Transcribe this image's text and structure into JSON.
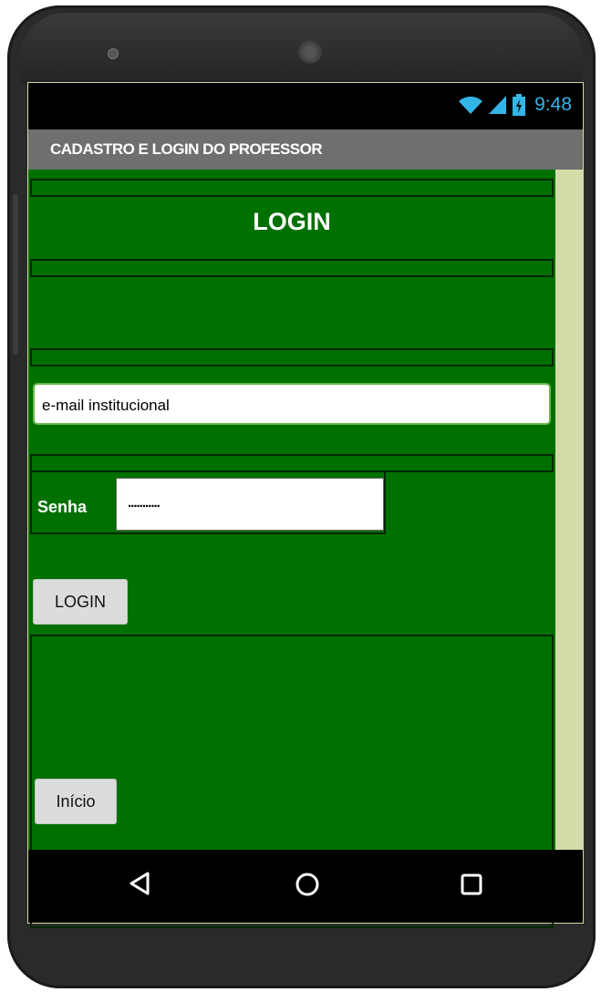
{
  "status_bar": {
    "time": "9:48",
    "icons": [
      "wifi-icon",
      "signal-icon",
      "battery-icon"
    ],
    "accent_color": "#33b5e5"
  },
  "app_bar": {
    "title": "CADASTRO E LOGIN DO PROFESSOR"
  },
  "screen": {
    "background_color": "#007000",
    "heading": "LOGIN",
    "email_field": {
      "value": "e-mail institucional"
    },
    "password": {
      "label": "Senha",
      "value": "..........."
    },
    "login_button": {
      "label": "LOGIN"
    },
    "inicio_button": {
      "label": "Início"
    }
  },
  "nav_bar": {
    "icons": [
      "back-icon",
      "home-icon",
      "recents-icon"
    ]
  }
}
